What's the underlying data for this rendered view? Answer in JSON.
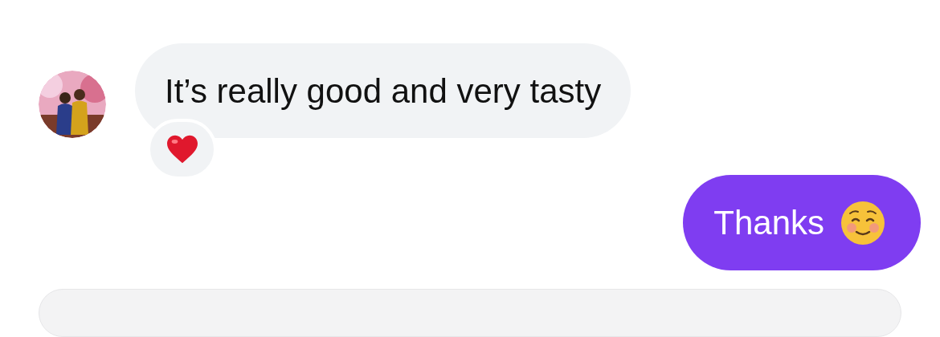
{
  "messages": [
    {
      "kind": "incoming",
      "text": "It’s really good and very tasty",
      "reaction": {
        "kind": "heart"
      }
    },
    {
      "kind": "outgoing",
      "text": "Thanks",
      "emoji": {
        "kind": "smiling-face"
      }
    }
  ],
  "composer": {
    "kind": "field"
  }
}
